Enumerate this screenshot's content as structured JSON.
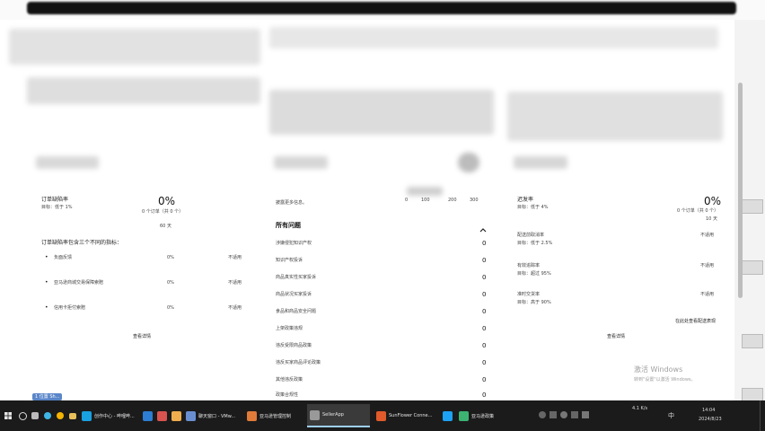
{
  "left": {
    "title": "订单缺陷率",
    "target": "目标：低于 1%",
    "value": "0%",
    "orders": "0 个订单（共 0 个）",
    "days": "60 天",
    "subtitle": "订单缺陷率包含三个不同的指标：",
    "metrics": [
      {
        "name": "负面反馈",
        "value": "0%",
        "status": "不适用"
      },
      {
        "name": "亚马逊商城交易保障索赔",
        "value": "0%",
        "status": "不适用"
      },
      {
        "name": "信用卡拒付索赔",
        "value": "0%",
        "status": "不适用"
      }
    ],
    "details_link": "查看详情"
  },
  "middle": {
    "more_info": "披露更多信息。",
    "axis_ticks": [
      "0",
      "100",
      "200",
      "300"
    ],
    "section_title": "所有问题",
    "collapse_icon": "chevron-up-icon",
    "issues": [
      {
        "name": "涉嫌侵犯知识产权",
        "count": "0"
      },
      {
        "name": "知识产权投诉",
        "count": "0"
      },
      {
        "name": "商品真实性买家投诉",
        "count": "0"
      },
      {
        "name": "商品状况买家投诉",
        "count": "0"
      },
      {
        "name": "食品和商品安全问题",
        "count": "0"
      },
      {
        "name": "上架政策违规",
        "count": "0"
      },
      {
        "name": "违反受限商品政策",
        "count": "0"
      },
      {
        "name": "违反买家商品评论政策",
        "count": "0"
      },
      {
        "name": "其他违反政策",
        "count": "0"
      },
      {
        "name": "政策合规性",
        "count": "0"
      }
    ]
  },
  "right": {
    "title": "迟发率",
    "target": "目标：低于 4%",
    "value": "0%",
    "orders": "0 个订单（共 0 个）",
    "days": "10 天",
    "metrics": [
      {
        "name": "配送前取消率",
        "target": "目标：低于 2.5%",
        "status": "不适用"
      },
      {
        "name": "有效追踪率",
        "target": "目标：超过 95%",
        "status": "不适用"
      },
      {
        "name": "准时交货率",
        "target": "目标：高于 90%",
        "status": "不适用"
      }
    ],
    "shipping_link": "在此处查看配送表现",
    "details_link": "查看详情"
  },
  "watermark": {
    "line1": "激活 Windows",
    "line2": "转到\"设置\"以激活 Windows。"
  },
  "badge": "1 位置 Sh...",
  "taskbar": {
    "items": [
      {
        "label": "创作中心 - 哔哩哔...",
        "color": "#19a0e0"
      },
      {
        "label": "",
        "color": "#2d7dd2"
      },
      {
        "label": "",
        "color": "#d9534f"
      },
      {
        "label": "",
        "color": "#f0ad4e"
      },
      {
        "label": "",
        "color": "#5cb85c"
      },
      {
        "label": "聊天窗口 - VMw...",
        "color": "#6a8fd1"
      },
      {
        "label": "亚马逊管理控制",
        "color": "#e07b39"
      },
      {
        "label": "SellerApp",
        "color": "#999999"
      },
      {
        "label": "SunFlower Conne...",
        "color": "#e05a2b"
      },
      {
        "label": "",
        "color": "#1da1f2"
      },
      {
        "label": "亚马逊政策",
        "color": "#3cb371"
      }
    ],
    "tray_network": "4.1 K/s",
    "tray_time": "14:04",
    "tray_date": "2024/8/23",
    "ime": "中"
  }
}
